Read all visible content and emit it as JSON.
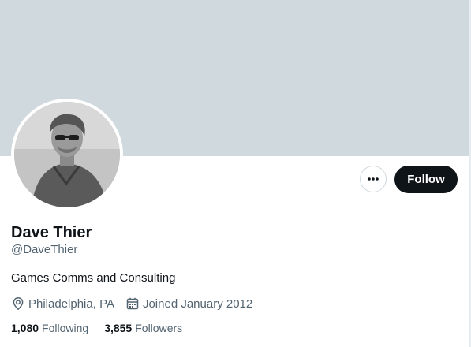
{
  "profile": {
    "name": "Dave Thier",
    "handle": "@DaveThier",
    "bio": "Games Comms and Consulting",
    "location": "Philadelphia, PA",
    "joined": "Joined January 2012"
  },
  "actions": {
    "follow_label": "Follow",
    "more_icon": "more-horizontal-icon"
  },
  "stats": {
    "following_count": "1,080",
    "following_label": "Following",
    "followers_count": "3,855",
    "followers_label": "Followers"
  },
  "icons": {
    "location": "location-pin-icon",
    "joined": "calendar-icon"
  },
  "colors": {
    "banner": "#cfd9de",
    "follow_bg": "#0f1419",
    "text_primary": "#0f1419",
    "text_secondary": "#536471"
  }
}
